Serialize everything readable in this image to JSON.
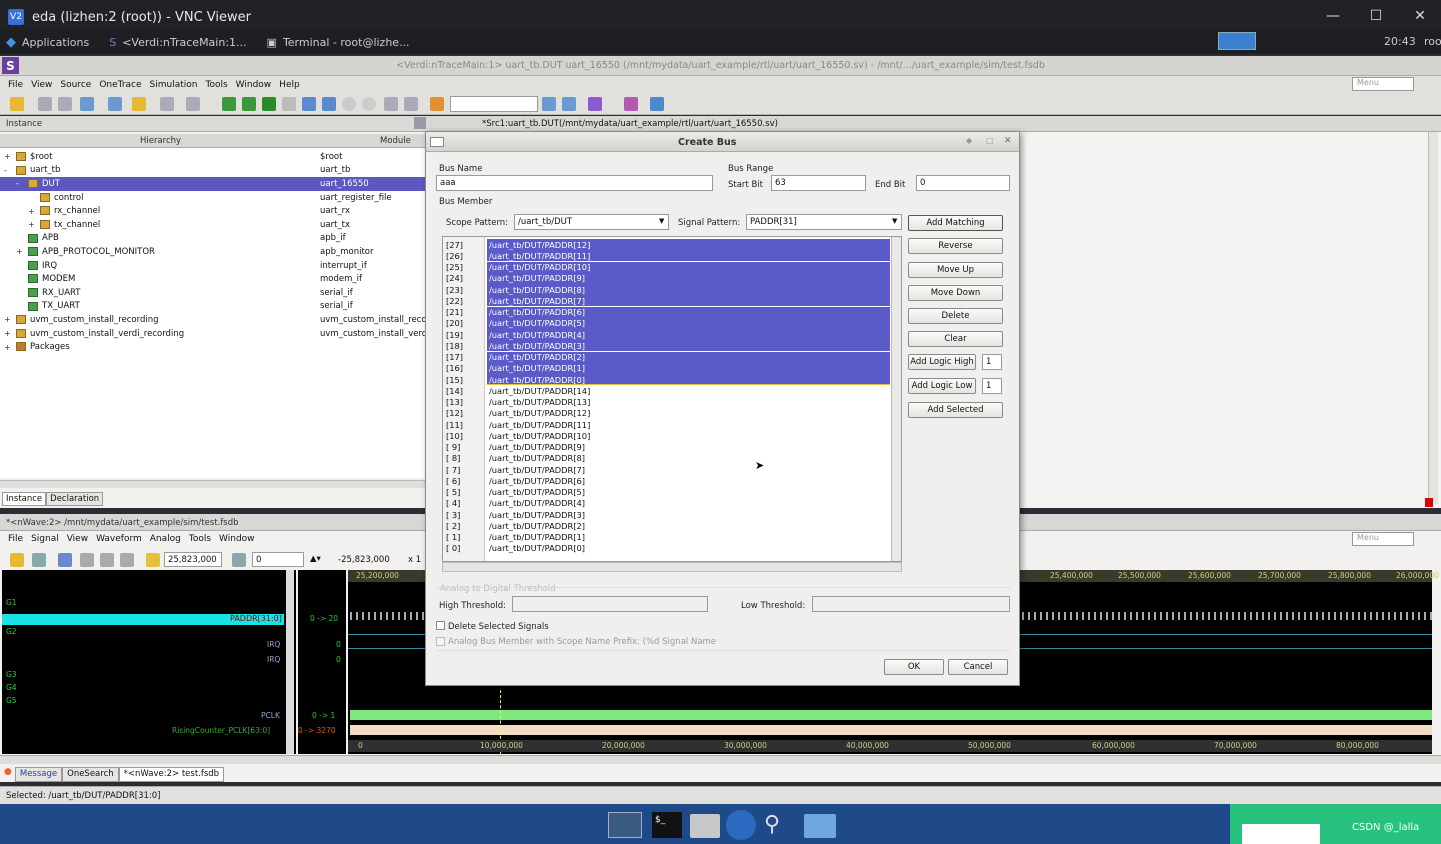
{
  "vnc": {
    "title": "eda (lizhen:2 (root)) - VNC Viewer",
    "logo": "V2"
  },
  "gnome": {
    "applications": "Applications",
    "task1": "<Verdi:nTraceMain:1...",
    "task2": "Terminal - root@lizhe...",
    "time": "20:43",
    "user": "root"
  },
  "verdi": {
    "title": "<Verdi:nTraceMain:1> uart_tb.DUT uart_16550 (/mnt/mydata/uart_example/rtl/uart/uart_16550.sv) - /mnt/.../uart_example/sim/test.fsdb",
    "menu": [
      "File",
      "View",
      "Source",
      "OneTrace",
      "Simulation",
      "Tools",
      "Window",
      "Help"
    ],
    "menu_box": "Menu"
  },
  "instance": {
    "title": "Instance",
    "col_hierarchy": "Hierarchy",
    "col_module": "Module",
    "rows": [
      {
        "name": "$root",
        "module": "$root",
        "indent": 0,
        "exp": "+",
        "icon": "folder"
      },
      {
        "name": "uart_tb",
        "module": "uart_tb",
        "indent": 0,
        "exp": "-",
        "icon": "folder"
      },
      {
        "name": "DUT",
        "module": "uart_16550",
        "indent": 1,
        "exp": "-",
        "icon": "folder",
        "selected": true
      },
      {
        "name": "control",
        "module": "uart_register_file",
        "indent": 2,
        "exp": "",
        "icon": "folder"
      },
      {
        "name": "rx_channel",
        "module": "uart_rx",
        "indent": 2,
        "exp": "+",
        "icon": "folder"
      },
      {
        "name": "tx_channel",
        "module": "uart_tx",
        "indent": 2,
        "exp": "+",
        "icon": "folder"
      },
      {
        "name": "APB",
        "module": "apb_if",
        "indent": 1,
        "exp": "",
        "icon": "green"
      },
      {
        "name": "APB_PROTOCOL_MONITOR",
        "module": "apb_monitor",
        "indent": 1,
        "exp": "+",
        "icon": "green"
      },
      {
        "name": "IRQ",
        "module": "interrupt_if",
        "indent": 1,
        "exp": "",
        "icon": "green"
      },
      {
        "name": "MODEM",
        "module": "modem_if",
        "indent": 1,
        "exp": "",
        "icon": "green"
      },
      {
        "name": "RX_UART",
        "module": "serial_if",
        "indent": 1,
        "exp": "",
        "icon": "green"
      },
      {
        "name": "TX_UART",
        "module": "serial_if",
        "indent": 1,
        "exp": "",
        "icon": "green"
      },
      {
        "name": "uvm_custom_install_recording",
        "module": "uvm_custom_install_reco",
        "indent": 0,
        "exp": "+",
        "icon": "folder"
      },
      {
        "name": "uvm_custom_install_verdi_recording",
        "module": "uvm_custom_install_verd",
        "indent": 0,
        "exp": "+",
        "icon": "folder"
      },
      {
        "name": "Packages",
        "module": "",
        "indent": 0,
        "exp": "+",
        "icon": "pkg"
      }
    ],
    "tabs": [
      "Instance",
      "Declaration"
    ]
  },
  "src": {
    "title": "*Src1:uart_tb.DUT(/mnt/mydata/uart_example/rtl/uart/uart_16550.sv)"
  },
  "dialog": {
    "title": "Create Bus",
    "bus_name_label": "Bus Name",
    "bus_name": "aaa",
    "bus_range_label": "Bus Range",
    "start_bit_label": "Start Bit",
    "start_bit": "63",
    "end_bit_label": "End Bit",
    "end_bit": "0",
    "bus_member_label": "Bus Member",
    "scope_label": "Scope Pattern:",
    "scope": "/uart_tb/DUT",
    "signal_label": "Signal Pattern:",
    "signal": "PADDR[31]",
    "members": [
      {
        "idx": "[27]",
        "sig": "/uart_tb/DUT/PADDR[12]",
        "sel": true
      },
      {
        "idx": "[26]",
        "sig": "/uart_tb/DUT/PADDR[11]",
        "sel": true
      },
      {
        "idx": "[25]",
        "sig": "/uart_tb/DUT/PADDR[10]",
        "sel": true
      },
      {
        "idx": "[24]",
        "sig": "/uart_tb/DUT/PADDR[9]",
        "sel": true
      },
      {
        "idx": "[23]",
        "sig": "/uart_tb/DUT/PADDR[8]",
        "sel": true
      },
      {
        "idx": "[22]",
        "sig": "/uart_tb/DUT/PADDR[7]",
        "sel": true
      },
      {
        "idx": "[21]",
        "sig": "/uart_tb/DUT/PADDR[6]",
        "sel": true
      },
      {
        "idx": "[20]",
        "sig": "/uart_tb/DUT/PADDR[5]",
        "sel": true
      },
      {
        "idx": "[19]",
        "sig": "/uart_tb/DUT/PADDR[4]",
        "sel": true
      },
      {
        "idx": "[18]",
        "sig": "/uart_tb/DUT/PADDR[3]",
        "sel": true
      },
      {
        "idx": "[17]",
        "sig": "/uart_tb/DUT/PADDR[2]",
        "sel": true
      },
      {
        "idx": "[16]",
        "sig": "/uart_tb/DUT/PADDR[1]",
        "sel": true
      },
      {
        "idx": "[15]",
        "sig": "/uart_tb/DUT/PADDR[0]",
        "sel": true
      },
      {
        "idx": "[14]",
        "sig": "/uart_tb/DUT/PADDR[14]",
        "sel": false
      },
      {
        "idx": "[13]",
        "sig": "/uart_tb/DUT/PADDR[13]",
        "sel": false
      },
      {
        "idx": "[12]",
        "sig": "/uart_tb/DUT/PADDR[12]",
        "sel": false
      },
      {
        "idx": "[11]",
        "sig": "/uart_tb/DUT/PADDR[11]",
        "sel": false
      },
      {
        "idx": "[10]",
        "sig": "/uart_tb/DUT/PADDR[10]",
        "sel": false
      },
      {
        "idx": "[ 9]",
        "sig": "/uart_tb/DUT/PADDR[9]",
        "sel": false
      },
      {
        "idx": "[ 8]",
        "sig": "/uart_tb/DUT/PADDR[8]",
        "sel": false
      },
      {
        "idx": "[ 7]",
        "sig": "/uart_tb/DUT/PADDR[7]",
        "sel": false
      },
      {
        "idx": "[ 6]",
        "sig": "/uart_tb/DUT/PADDR[6]",
        "sel": false
      },
      {
        "idx": "[ 5]",
        "sig": "/uart_tb/DUT/PADDR[5]",
        "sel": false
      },
      {
        "idx": "[ 4]",
        "sig": "/uart_tb/DUT/PADDR[4]",
        "sel": false
      },
      {
        "idx": "[ 3]",
        "sig": "/uart_tb/DUT/PADDR[3]",
        "sel": false
      },
      {
        "idx": "[ 2]",
        "sig": "/uart_tb/DUT/PADDR[2]",
        "sel": false
      },
      {
        "idx": "[ 1]",
        "sig": "/uart_tb/DUT/PADDR[1]",
        "sel": false
      },
      {
        "idx": "[ 0]",
        "sig": "/uart_tb/DUT/PADDR[0]",
        "sel": false
      }
    ],
    "buttons": [
      "Add Matching",
      "Reverse",
      "Move Up",
      "Move Down",
      "Delete",
      "Clear"
    ],
    "logic_high_label": "Add Logic High",
    "logic_high": "1",
    "logic_low_label": "Add Logic Low",
    "logic_low": "1",
    "add_selected": "Add Selected",
    "analog_label": "Analog to Digital Threshold",
    "high_label": "High Threshold:",
    "low_label": "Low Threshold:",
    "delete_sel": "Delete Selected Signals",
    "analog_prefix": "Analog Bus Member with Scope Name Prefix: (%d Signal Name",
    "ok": "OK",
    "cancel": "Cancel"
  },
  "nwave": {
    "title": "*<nWave:2> /mnt/mydata/uart_example/sim/test.fsdb",
    "menu": [
      "File",
      "Signal",
      "View",
      "Waveform",
      "Analog",
      "Tools",
      "Window"
    ],
    "menu_box": "Menu",
    "cursor": "25,823,000",
    "delta": "0",
    "marker": "-25,823,000",
    "zoom": "x 1",
    "groups": [
      "G1",
      "G2",
      "G3",
      "G4",
      "G5"
    ],
    "signals": [
      {
        "name": "PADDR[31:0]",
        "value": "0 -> 20"
      },
      {
        "name": "IRQ",
        "value": "0"
      },
      {
        "name": "IRQ",
        "value": "0"
      },
      {
        "name": "PCLK",
        "value": "0 -> 1"
      },
      {
        "name": "RisingCounter_PCLK[63:0]",
        "value": "0 -> 3270"
      }
    ],
    "top_ticks": [
      "25,200,000",
      "25,400,000",
      "25,500,000",
      "25,600,000",
      "25,700,000",
      "25,800,000",
      "26,000,000"
    ],
    "ticks": [
      "0",
      "10,000,000",
      "20,000,000",
      "30,000,000",
      "40,000,000",
      "50,000,000",
      "60,000,000",
      "70,000,000",
      "80,000,000"
    ]
  },
  "bottom_tabs": [
    "Message",
    "OneSearch",
    "*<nWave:2> test.fsdb"
  ],
  "status": "Selected: /uart_tb/DUT/PADDR[31:0]",
  "watermark": "CSDN @_lalla"
}
